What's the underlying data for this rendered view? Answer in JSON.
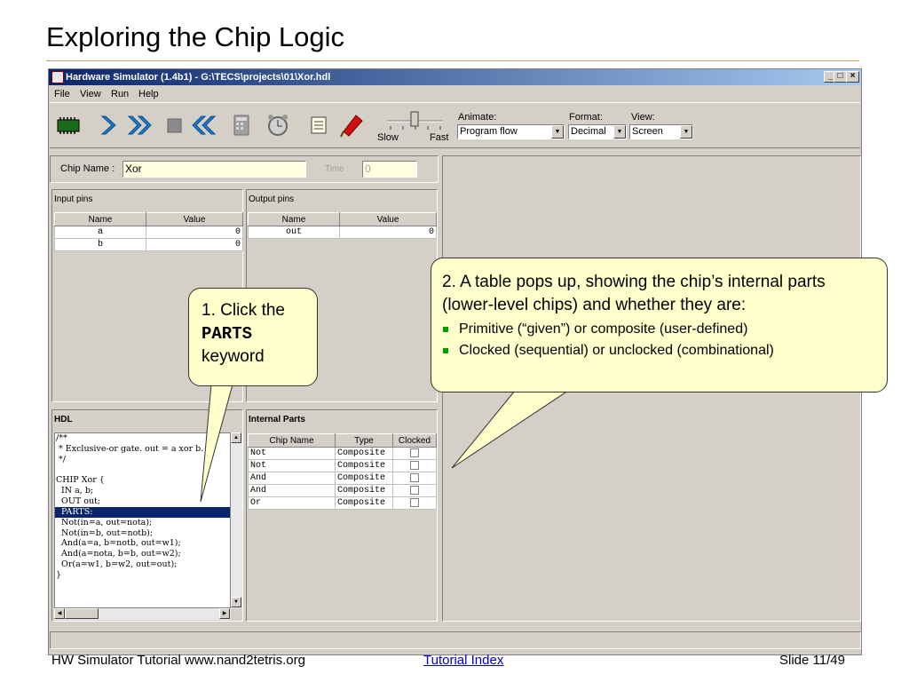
{
  "slide": {
    "title": "Exploring the Chip Logic",
    "footer_left": "HW Simulator Tutorial  www.nand2tetris.org",
    "footer_link": "Tutorial Index",
    "footer_right": "Slide 11/49"
  },
  "window": {
    "title": "Hardware Simulator (1.4b1) - G:\\TECS\\projects\\01\\Xor.hdl",
    "menu": [
      "File",
      "View",
      "Run",
      "Help"
    ],
    "min": "_",
    "max": "□",
    "close": "×"
  },
  "toolbar": {
    "speed_slow": "Slow",
    "speed_fast": "Fast",
    "animate_label": "Animate:",
    "animate_value": "Program flow",
    "format_label": "Format:",
    "format_value": "Decimal",
    "view_label": "View:",
    "view_value": "Screen",
    "icons": [
      "chip-load-icon",
      "single-step-icon",
      "run-icon",
      "stop-icon",
      "reset-icon",
      "eval-icon",
      "clock-icon",
      "script-icon",
      "breakpoint-icon"
    ]
  },
  "chip": {
    "name_label": "Chip Name :",
    "name_value": "Xor",
    "time_label": "Time :",
    "time_value": "0"
  },
  "input_pins": {
    "title": "Input pins",
    "headers": [
      "Name",
      "Value"
    ],
    "rows": [
      [
        "a",
        "0"
      ],
      [
        "b",
        "0"
      ]
    ]
  },
  "output_pins": {
    "title": "Output pins",
    "headers": [
      "Name",
      "Value"
    ],
    "rows": [
      [
        "out",
        "0"
      ]
    ]
  },
  "hdl": {
    "title": "HDL",
    "lines": [
      "/**",
      " * Exclusive-or gate. out = a xor b.",
      " */",
      "",
      "CHIP Xor {",
      "  IN a, b;",
      "  OUT out;",
      "  PARTS:",
      "  Not(in=a, out=nota);",
      "  Not(in=b, out=notb);",
      "  And(a=a, b=notb, out=w1);",
      "  And(a=nota, b=b, out=w2);",
      "  Or(a=w1, b=w2, out=out);",
      "}"
    ]
  },
  "internal_parts": {
    "title": "Internal Parts",
    "headers": [
      "Chip Name",
      "Type",
      "Clocked"
    ],
    "rows": [
      [
        "Not",
        "Composite"
      ],
      [
        "Not",
        "Composite"
      ],
      [
        "And",
        "Composite"
      ],
      [
        "And",
        "Composite"
      ],
      [
        "Or",
        "Composite"
      ]
    ]
  },
  "callout1": {
    "line1": "1. Click the",
    "keyword": "PARTS",
    "line3": "keyword"
  },
  "callout2": {
    "text": "2. A table pops up, showing the chip’s internal parts (lower-level chips) and whether they are:",
    "bullets": [
      "Primitive (“given”) or composite (user-defined)",
      "Clocked (sequential) or unclocked (combinational)"
    ],
    "bullet_color": "#00a000"
  }
}
